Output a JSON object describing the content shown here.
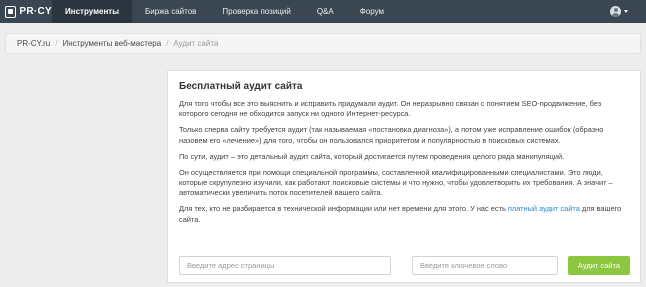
{
  "navbar": {
    "logo_text": "PR·CY",
    "items": [
      {
        "label": "Инструменты",
        "active": true
      },
      {
        "label": "Биржа сайтов",
        "active": false
      },
      {
        "label": "Проверка позиций",
        "active": false
      },
      {
        "label": "Q&A",
        "active": false
      },
      {
        "label": "Форум",
        "active": false
      }
    ],
    "user_icon": "user-avatar-icon",
    "dropdown_icon": "caret-down-icon"
  },
  "breadcrumb": {
    "items": [
      "PR-CY.ru",
      "Инструменты веб-мастера"
    ],
    "current": "Аудит сайта",
    "separator": "/"
  },
  "panel": {
    "title": "Бесплатный аудит сайта",
    "paragraphs": [
      "Для того чтобы все это выяснить и исправить придумали аудит. Он неразрывно связан с понятием SEO-продвижение, без которого сегодня не обходится запуск ни одного Интернет-ресурса.",
      "Только сперва сайту требуется аудит (так называемая «постановка диагноза»), а потом уже исправление ошибок (образно назовем его «лечение») для того, чтобы он пользовался приоритетом и популярностью в поисковых системах.",
      "По сути, аудит – это детальный аудит сайта, который достигается путем проведения целого ряда манипуляций.",
      "Он осуществляется при помощи специальной программы, составленной квалифицированными специалистами. Это люди, которые скрупулезно изучили, как работают поисковые системы и что нужно, чтобы удовлетворить их требования. А значит – автоматически увеличить поток посетителей вашего сайта."
    ],
    "last_paragraph": {
      "before": "Для тех, кто не разбирается в технической информации или нет времени для этого. У нас есть ",
      "link": "платный аудит сайта",
      "after": " для вашего сайта."
    },
    "url_input_placeholder": "Введите адрес страницы",
    "keyword_input_placeholder": "Введите ключевое слово",
    "submit_label": "Аудит сайта"
  },
  "colors": {
    "navbar": "#3a4651",
    "navbar_active": "#2b3540",
    "button": "#8dc63f",
    "link": "#2e8ac0",
    "background": "#ededed"
  }
}
